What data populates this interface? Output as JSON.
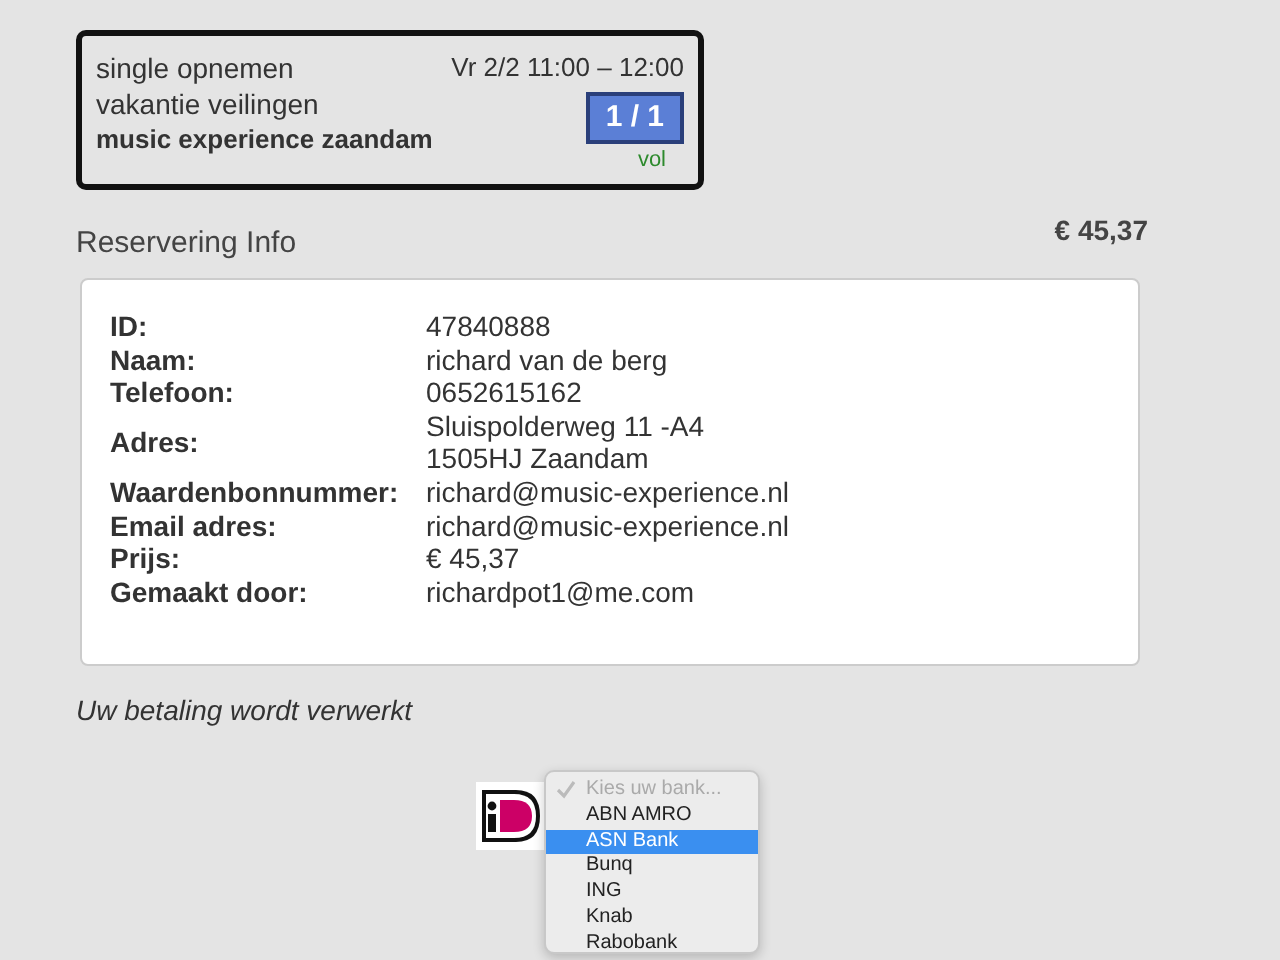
{
  "booking": {
    "title": "single opnemen",
    "subtitle": "vakantie veilingen",
    "location": "music experience zaandam",
    "datetime": "Vr 2/2 11:00 – 12:00",
    "count": "1 / 1",
    "status": "vol"
  },
  "reservation": {
    "heading": "Reservering Info",
    "total": "€ 45,37",
    "fields": [
      {
        "label": "ID:",
        "value": [
          "47840888"
        ]
      },
      {
        "label": "Naam:",
        "value": [
          "richard van de berg"
        ]
      },
      {
        "label": "Telefoon:",
        "value": [
          "0652615162"
        ]
      },
      {
        "label": "Adres:",
        "value": [
          "Sluispolderweg 11 -A4",
          "1505HJ Zaandam"
        ]
      },
      {
        "label": "Waardenbonnummer:",
        "value": [
          "richard@music-experience.nl"
        ]
      },
      {
        "label": "Email adres:",
        "value": [
          "richard@music-experience.nl"
        ]
      },
      {
        "label": "Prijs:",
        "value": [
          "€ 45,37"
        ]
      },
      {
        "label": "Gemaakt door:",
        "value": [
          "richardpot1@me.com"
        ]
      }
    ]
  },
  "payment_message": "Uw betaling wordt verwerkt",
  "bank_menu": {
    "items": [
      {
        "label": "Kies uw bank...",
        "checked": true,
        "disabled": true,
        "selected": false
      },
      {
        "label": "ABN AMRO",
        "checked": false,
        "disabled": false,
        "selected": false
      },
      {
        "label": "ASN Bank",
        "checked": false,
        "disabled": false,
        "selected": true
      },
      {
        "label": "Bunq",
        "checked": false,
        "disabled": false,
        "selected": false
      },
      {
        "label": "ING",
        "checked": false,
        "disabled": false,
        "selected": false
      },
      {
        "label": "Knab",
        "checked": false,
        "disabled": false,
        "selected": false
      },
      {
        "label": "Rabobank",
        "checked": false,
        "disabled": false,
        "selected": false
      }
    ]
  }
}
